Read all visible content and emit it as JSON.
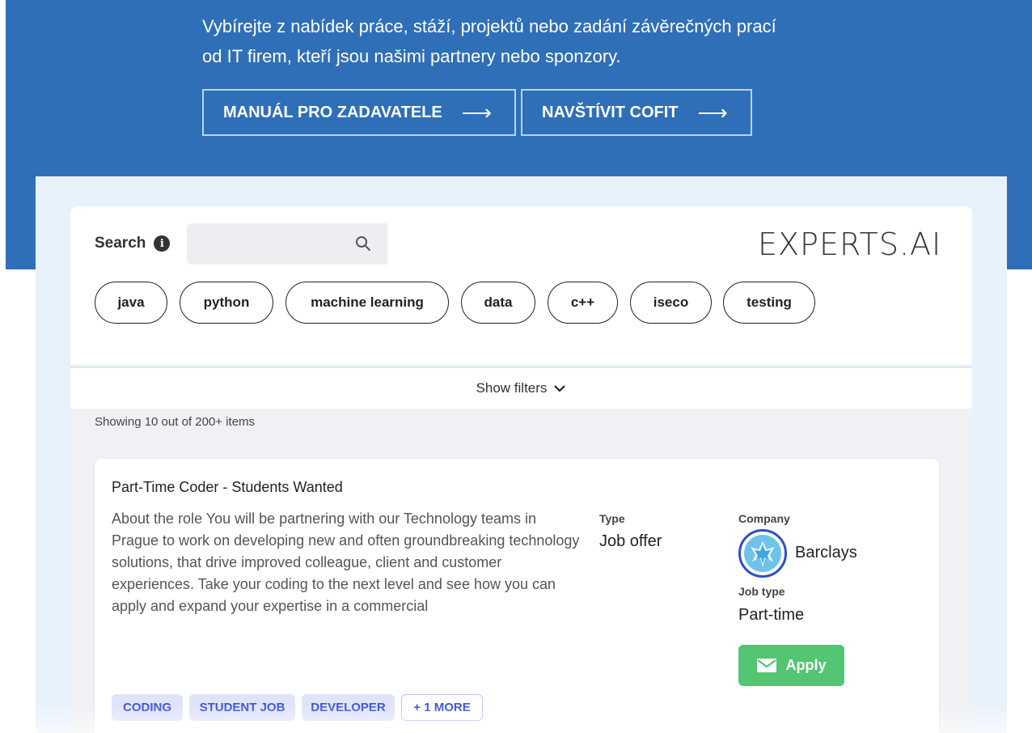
{
  "hero": {
    "line1": "Vybírejte z nabídek práce, stáží, projektů nebo zadání závěrečných prací",
    "line2": "od IT firem, kteří jsou našimi partnery nebo sponzory.",
    "buttons": [
      {
        "label": "MANUÁL PRO ZADAVATELE",
        "arrow": "⟶"
      },
      {
        "label": "NAVŠTÍVIT COFIT",
        "arrow": "⟶"
      }
    ]
  },
  "search": {
    "label": "Search",
    "info_icon": "i",
    "placeholder": "",
    "value": ""
  },
  "brand_logo": "EXPERTS.AI",
  "chips": [
    "java",
    "python",
    "machine learning",
    "data",
    "c++",
    "iseco",
    "testing"
  ],
  "filters": {
    "label": "Show filters"
  },
  "results": {
    "showing": "Showing 10 out of 200+ items"
  },
  "job": {
    "title": "Part-Time Coder - Students Wanted",
    "description": "About the role You will be partnering with our Technology teams in Prague to work on developing new and often groundbreaking technology solutions, that drive improved colleague, client and customer experiences. Take your coding to the next level and see how you can apply and expand your expertise in a commercial",
    "type_label": "Type",
    "type_value": "Job offer",
    "company_label": "Company",
    "company_name": "Barclays",
    "jobtype_label": "Job type",
    "jobtype_value": "Part-time",
    "apply_label": "Apply",
    "tags": [
      "CODING",
      "STUDENT JOB",
      "DEVELOPER"
    ],
    "more_tag": "+ 1 MORE"
  },
  "colors": {
    "hero_bg": "#2f6fb8",
    "apply_green": "#52c672",
    "tag_blue": "#3a52d3",
    "barclays_blue": "#2a4fc9"
  }
}
